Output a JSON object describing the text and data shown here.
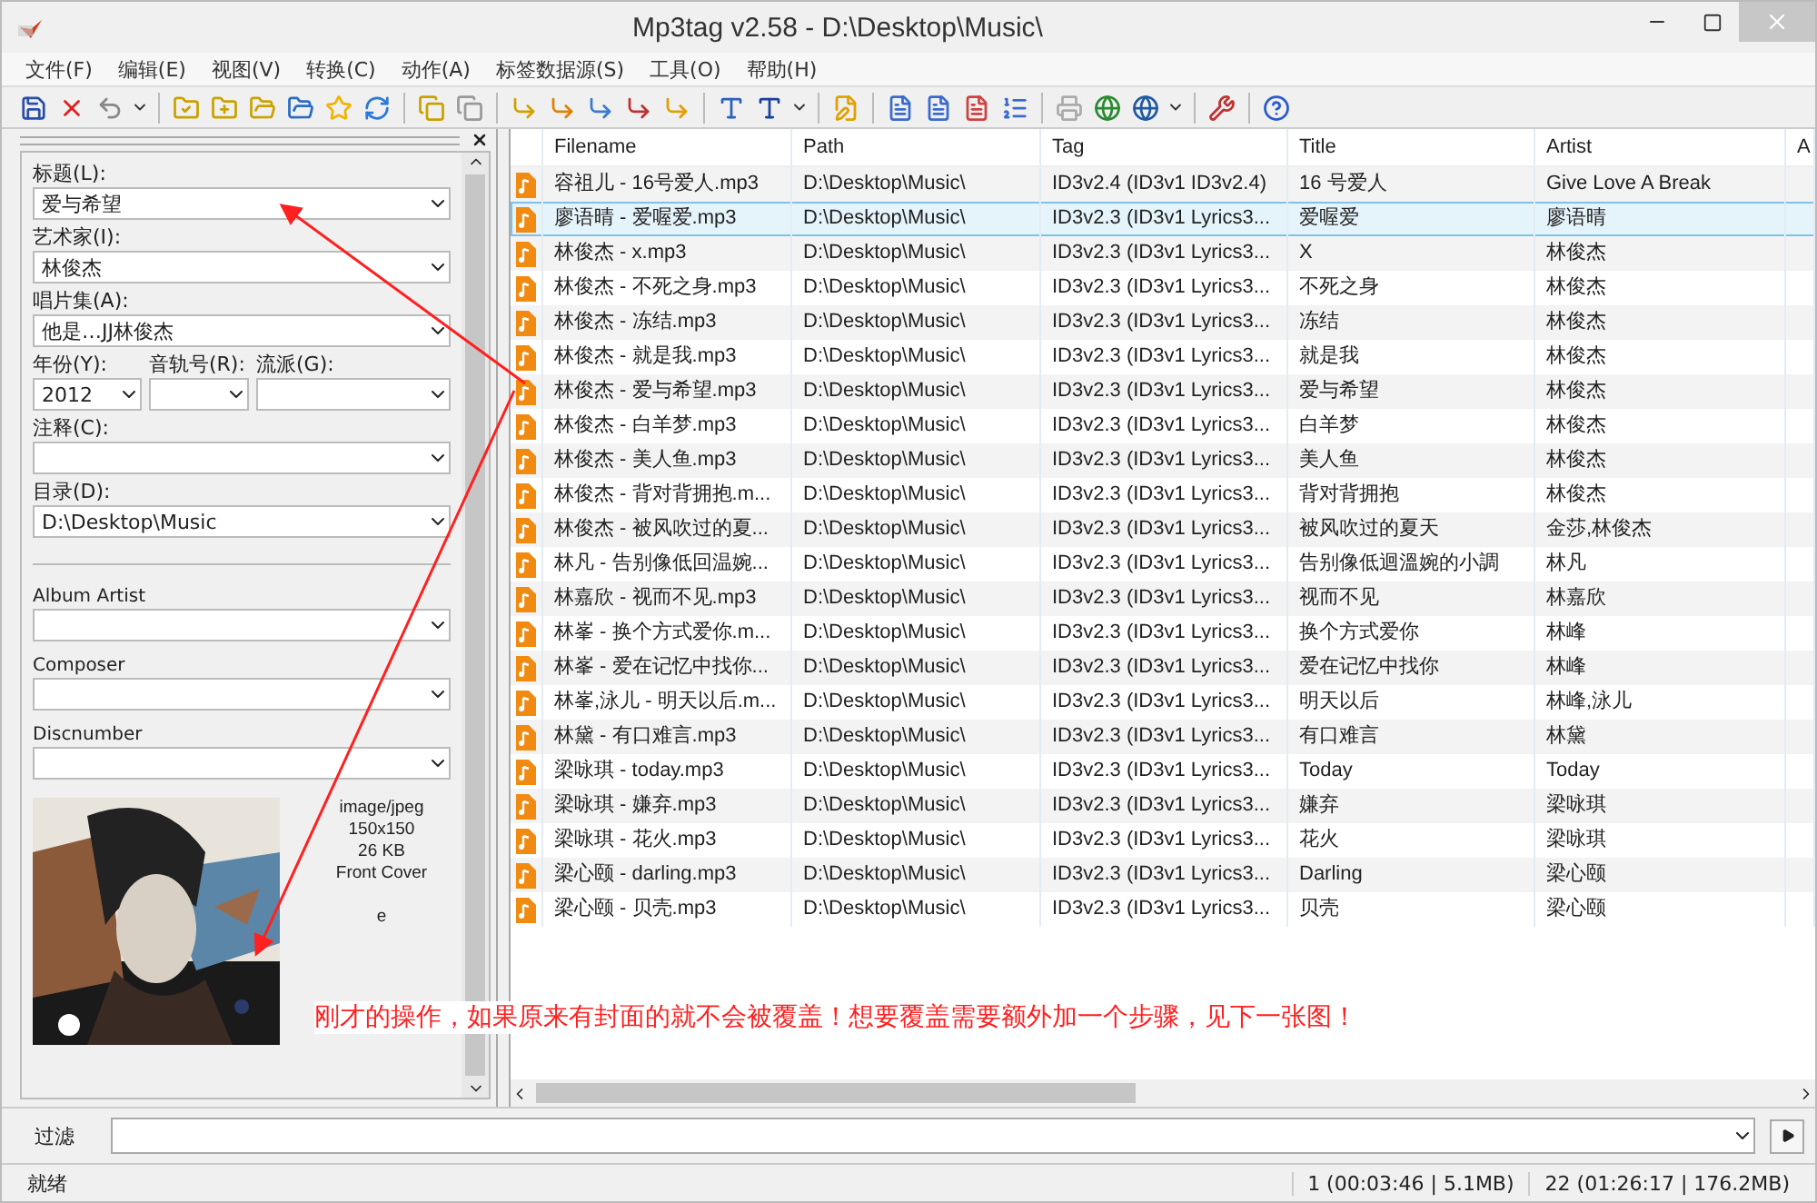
{
  "window": {
    "title": "Mp3tag v2.58  -  D:\\Desktop\\Music\\"
  },
  "menu": [
    "文件(F)",
    "编辑(E)",
    "视图(V)",
    "转换(C)",
    "动作(A)",
    "标签数据源(S)",
    "工具(O)",
    "帮助(H)"
  ],
  "side_panel": {
    "fields": [
      {
        "kind": "full",
        "label": "标题(L):",
        "value": "爱与希望"
      },
      {
        "kind": "full",
        "label": "艺术家(I):",
        "value": "林俊杰"
      },
      {
        "kind": "full",
        "label": "唱片集(A):",
        "value": "他是…JJ林俊杰"
      },
      {
        "kind": "triple",
        "items": [
          {
            "label": "年份(Y):",
            "value": "2012"
          },
          {
            "label": "音轨号(R):"
          },
          {
            "label": "流派(G):"
          }
        ]
      },
      {
        "kind": "full",
        "label": "注释(C):"
      },
      {
        "kind": "full",
        "label": "目录(D):",
        "value": "D:\\Desktop\\Music"
      },
      {
        "kind": "separator"
      },
      {
        "kind": "small",
        "label": "Album Artist"
      },
      {
        "kind": "small",
        "label": "Composer"
      },
      {
        "kind": "small",
        "label": "Discnumber"
      }
    ],
    "cover": {
      "kind": "picture",
      "info": [
        "image/jpeg",
        "150x150",
        "26 KB",
        "Front Cover",
        "e"
      ]
    }
  },
  "table": {
    "columns": [
      "Filename",
      "Path",
      "Tag",
      "Title",
      "Artist",
      "A"
    ],
    "rows": [
      {
        "selected": false,
        "cells": [
          "容祖儿 - 16号爱人.mp3",
          "D:\\Desktop\\Music\\",
          "ID3v2.4 (ID3v1 ID3v2.4)",
          "16 号爱人",
          "Give Love A Break"
        ]
      },
      {
        "selected": true,
        "cells": [
          "廖语晴 - 爱喔爱.mp3",
          "D:\\Desktop\\Music\\",
          "ID3v2.3 (ID3v1 Lyrics3...",
          "爱喔爱",
          "廖语晴"
        ]
      },
      {
        "selected": false,
        "cells": [
          "林俊杰 - x.mp3",
          "D:\\Desktop\\Music\\",
          "ID3v2.3 (ID3v1 Lyrics3...",
          "X",
          "林俊杰"
        ]
      },
      {
        "selected": false,
        "cells": [
          "林俊杰 - 不死之身.mp3",
          "D:\\Desktop\\Music\\",
          "ID3v2.3 (ID3v1 Lyrics3...",
          "不死之身",
          "林俊杰"
        ]
      },
      {
        "selected": false,
        "cells": [
          "林俊杰 - 冻结.mp3",
          "D:\\Desktop\\Music\\",
          "ID3v2.3 (ID3v1 Lyrics3...",
          "冻结",
          "林俊杰"
        ]
      },
      {
        "selected": false,
        "cells": [
          "林俊杰 - 就是我.mp3",
          "D:\\Desktop\\Music\\",
          "ID3v2.3 (ID3v1 Lyrics3...",
          "就是我",
          "林俊杰"
        ]
      },
      {
        "selected": false,
        "cells": [
          "林俊杰 - 爱与希望.mp3",
          "D:\\Desktop\\Music\\",
          "ID3v2.3 (ID3v1 Lyrics3...",
          "爱与希望",
          "林俊杰"
        ]
      },
      {
        "selected": false,
        "cells": [
          "林俊杰 - 白羊梦.mp3",
          "D:\\Desktop\\Music\\",
          "ID3v2.3 (ID3v1 Lyrics3...",
          "白羊梦",
          "林俊杰"
        ]
      },
      {
        "selected": false,
        "cells": [
          "林俊杰 - 美人鱼.mp3",
          "D:\\Desktop\\Music\\",
          "ID3v2.3 (ID3v1 Lyrics3...",
          "美人鱼",
          "林俊杰"
        ]
      },
      {
        "selected": false,
        "cells": [
          "林俊杰 - 背对背拥抱.m...",
          "D:\\Desktop\\Music\\",
          "ID3v2.3 (ID3v1 Lyrics3...",
          "背对背拥抱",
          "林俊杰"
        ]
      },
      {
        "selected": false,
        "cells": [
          "林俊杰 - 被风吹过的夏...",
          "D:\\Desktop\\Music\\",
          "ID3v2.3 (ID3v1 Lyrics3...",
          "被风吹过的夏天",
          "金莎,林俊杰"
        ]
      },
      {
        "selected": false,
        "cells": [
          "林凡 - 告别像低回温婉...",
          "D:\\Desktop\\Music\\",
          "ID3v2.3 (ID3v1 Lyrics3...",
          "告别像低迴溫婉的小調",
          "林凡"
        ]
      },
      {
        "selected": false,
        "cells": [
          "林嘉欣 - 视而不见.mp3",
          "D:\\Desktop\\Music\\",
          "ID3v2.3 (ID3v1 Lyrics3...",
          "视而不见",
          "林嘉欣"
        ]
      },
      {
        "selected": false,
        "cells": [
          "林峯 - 换个方式爱你.m...",
          "D:\\Desktop\\Music\\",
          "ID3v2.3 (ID3v1 Lyrics3...",
          "换个方式爱你",
          "林峰"
        ]
      },
      {
        "selected": false,
        "cells": [
          "林峯 - 爱在记忆中找你...",
          "D:\\Desktop\\Music\\",
          "ID3v2.3 (ID3v1 Lyrics3...",
          "爱在记忆中找你",
          "林峰"
        ]
      },
      {
        "selected": false,
        "cells": [
          "林峯,泳儿 - 明天以后.m...",
          "D:\\Desktop\\Music\\",
          "ID3v2.3 (ID3v1 Lyrics3...",
          "明天以后",
          "林峰,泳儿"
        ]
      },
      {
        "selected": false,
        "cells": [
          "林黛 - 有口难言.mp3",
          "D:\\Desktop\\Music\\",
          "ID3v2.3 (ID3v1 Lyrics3...",
          "有口难言",
          "林黛"
        ]
      },
      {
        "selected": false,
        "cells": [
          "梁咏琪 - today.mp3",
          "D:\\Desktop\\Music\\",
          "ID3v2.3 (ID3v1 Lyrics3...",
          "Today",
          "Today"
        ]
      },
      {
        "selected": false,
        "cells": [
          "梁咏琪 - 嫌弃.mp3",
          "D:\\Desktop\\Music\\",
          "ID3v2.3 (ID3v1 Lyrics3...",
          "嫌弃",
          "梁咏琪"
        ]
      },
      {
        "selected": false,
        "cells": [
          "梁咏琪 - 花火.mp3",
          "D:\\Desktop\\Music\\",
          "ID3v2.3 (ID3v1 Lyrics3...",
          "花火",
          "梁咏琪"
        ]
      },
      {
        "selected": false,
        "cells": [
          "梁心颐 - darling.mp3",
          "D:\\Desktop\\Music\\",
          "ID3v2.3 (ID3v1 Lyrics3...",
          "Darling",
          "梁心颐"
        ]
      },
      {
        "selected": false,
        "cells": [
          "梁心颐 - 贝壳.mp3",
          "D:\\Desktop\\Music\\",
          "ID3v2.3 (ID3v1 Lyrics3...",
          "贝壳",
          "梁心颐"
        ]
      }
    ]
  },
  "annotation": "刚才的操作，如果原来有封面的就不会被覆盖！想要覆盖需要额外加一个步骤，见下一张图！",
  "filter": {
    "label": "过滤"
  },
  "status_bar": {
    "left": "就绪",
    "selection": "1 (00:03:46 | 5.1MB)",
    "total": "22 (01:26:17 | 176.2MB)"
  }
}
